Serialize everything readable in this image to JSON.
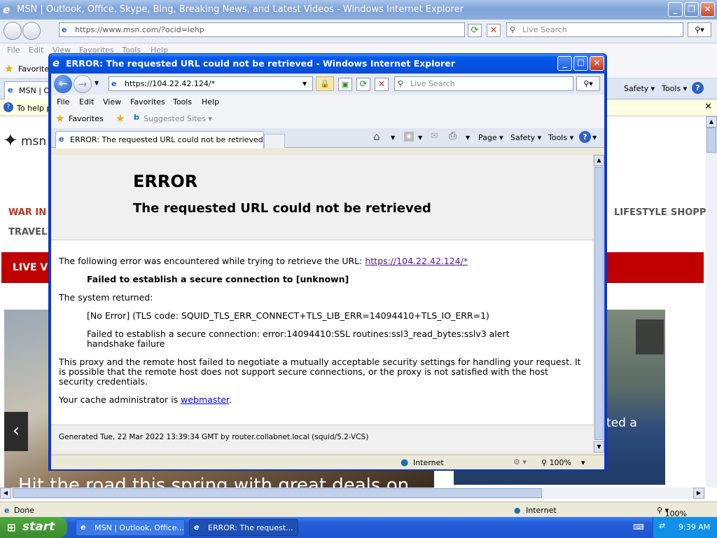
{
  "back_window": {
    "title": "MSN | Outlook, Office, Skype, Bing, Breaking News, and Latest Videos - Windows Internet Explorer",
    "address": "https://www.msn.com/?ocid=iehp",
    "search_placeholder": "Live Search",
    "menu": [
      "File",
      "Edit",
      "View",
      "Favorites",
      "Tools",
      "Help"
    ],
    "favorites_label": "Favorites",
    "tab_label": "MSN | O",
    "info_bar": "To help p",
    "toolbar": {
      "safety": "Safety",
      "tools": "Tools"
    },
    "msn_logo": "msn",
    "nav": {
      "war": "WAR IN U",
      "lifestyle": "LIFESTYLE",
      "shopping": "SHOPPI",
      "travel": "TRAVEL"
    },
    "live_banner": "LIVE VI",
    "headline": "Hit the road this spring with great deals on",
    "right_caption": "ted a",
    "status_done": "Done",
    "status_zone": "Internet",
    "zoom": "100%"
  },
  "front_window": {
    "title": "ERROR: The requested URL could not be retrieved - Windows Internet Explorer",
    "address": "https://104.22.42.124/*",
    "search_placeholder": "Live Search",
    "menu": [
      "File",
      "Edit",
      "View",
      "Favorites",
      "Tools",
      "Help"
    ],
    "favorites_label": "Favorites",
    "suggested_sites": "Suggested Sites",
    "tab_label": "ERROR: The requested URL could not be retrieved",
    "toolbar": {
      "page": "Page",
      "safety": "Safety",
      "tools": "Tools"
    },
    "status_zone": "Internet",
    "zoom": "100%"
  },
  "error_page": {
    "heading": "ERROR",
    "subheading": "The requested URL could not be retrieved",
    "intro": "The following error was encountered while trying to retrieve the URL:",
    "url_link": "https://104.22.42.124/*",
    "failure": "Failed to establish a secure connection to [unknown]",
    "system_returned": "The system returned:",
    "no_error": "[No Error] (TLS code: SQUID_TLS_ERR_CONNECT+TLS_LIB_ERR=14094410+TLS_IO_ERR=1)",
    "ssl_error_1": "Failed to establish a secure connection: error:14094410:SSL routines:ssl3_read_bytes:sslv3 alert",
    "ssl_error_2": "handshake failure",
    "proxy_1": "This proxy and the remote host failed to negotiate a mutually acceptable security settings for handling your request. It",
    "proxy_2": "is possible that the remote host does not support secure connections, or the proxy is not satisfied with the host",
    "proxy_3": "security credentials.",
    "cache_admin": "Your cache administrator is",
    "webmaster": "webmaster",
    "period": ".",
    "footer": "Generated Tue, 22 Mar 2022 13:39:34 GMT by router.collabnet.local (squid/5.2-VCS)"
  },
  "taskbar": {
    "start": "start",
    "items": [
      "MSN | Outlook, Office...",
      "ERROR: The request..."
    ],
    "clock": "9:39 AM"
  },
  "colors": {
    "xp_blue": "#0058ee",
    "msn_red": "#c00000",
    "start_green": "#3a8a2d"
  }
}
